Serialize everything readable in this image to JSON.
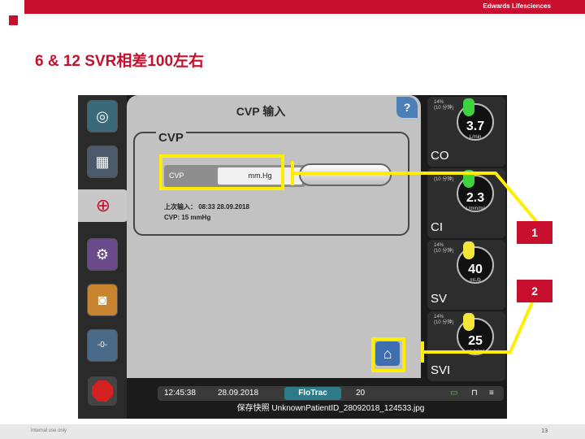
{
  "header": {
    "brand": "Edwards Lifesciences"
  },
  "slide": {
    "title": "6 & 12 SVR相差100左右"
  },
  "footer": {
    "left": "Internal use only",
    "page": "13"
  },
  "screen": {
    "panel_title": "CVP 输入",
    "help_label": "?",
    "section_label": "CVP",
    "cvp_field_label": "CVP",
    "cvp_unit": "mm.Hg",
    "pill_button_label": "",
    "last_entry_line1": "上次输入： 08:33 28.09.2018",
    "last_entry_line2": "CVP: 15 mmHg"
  },
  "tiles": [
    {
      "pct": "14%",
      "window": "(10 分钟)",
      "value": "3.7",
      "unit": "L/min",
      "name": "CO",
      "drop_color": "#3fd23f"
    },
    {
      "pct": "",
      "window": "(10 分钟)",
      "value": "2.3",
      "unit": "L/min/m²",
      "name": "CI",
      "drop_color": "#3fd23f"
    },
    {
      "pct": "14%",
      "window": "(10 分钟)",
      "value": "40",
      "unit": "mL/b",
      "name": "SV",
      "drop_color": "#f5e63a"
    },
    {
      "pct": "14%",
      "window": "(10 分钟)",
      "value": "25",
      "unit": "mL/b/m²",
      "name": "SVI",
      "drop_color": "#f5e63a"
    }
  ],
  "callouts": {
    "one": "1",
    "two": "2"
  },
  "statusbar": {
    "time": "12:45:38",
    "date": "28.09.2018",
    "mode": "FloTrac",
    "interval": "20",
    "snapshot": "保存快照 UnknownPatientID_28092018_124533.jpg"
  },
  "colors": {
    "brand_red": "#c8102e",
    "highlight_yellow": "#ffee00"
  }
}
